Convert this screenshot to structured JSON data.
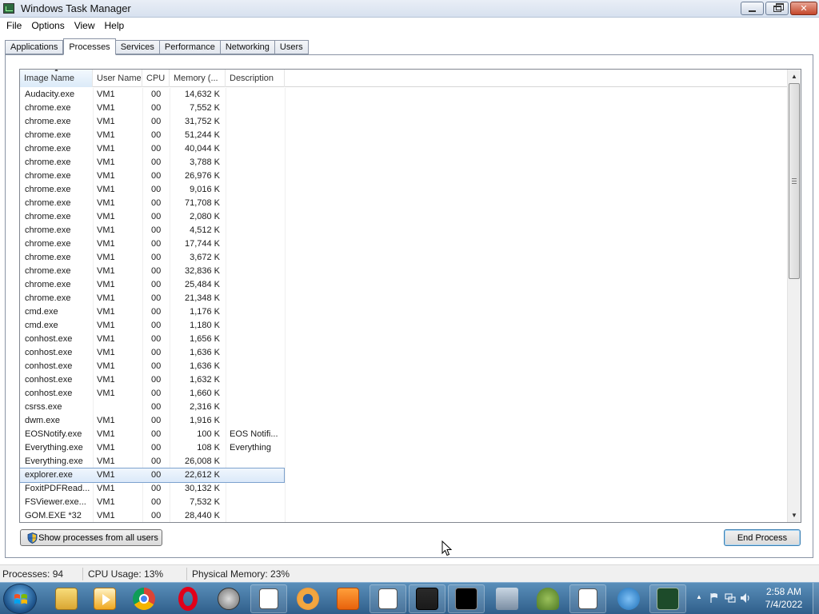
{
  "window": {
    "title": "Windows Task Manager"
  },
  "menu": [
    "File",
    "Options",
    "View",
    "Help"
  ],
  "tabs": [
    {
      "label": "Applications",
      "active": false
    },
    {
      "label": "Processes",
      "active": true
    },
    {
      "label": "Services",
      "active": false
    },
    {
      "label": "Performance",
      "active": false
    },
    {
      "label": "Networking",
      "active": false
    },
    {
      "label": "Users",
      "active": false
    }
  ],
  "columns": {
    "name": "Image Name",
    "user": "User Name",
    "cpu": "CPU",
    "memory": "Memory (...",
    "description": "Description"
  },
  "processes": [
    {
      "name": "Audacity.exe",
      "user": "VM1",
      "cpu": "00",
      "memory": "14,632 K",
      "description": ""
    },
    {
      "name": "chrome.exe",
      "user": "VM1",
      "cpu": "00",
      "memory": "7,552 K",
      "description": ""
    },
    {
      "name": "chrome.exe",
      "user": "VM1",
      "cpu": "00",
      "memory": "31,752 K",
      "description": ""
    },
    {
      "name": "chrome.exe",
      "user": "VM1",
      "cpu": "00",
      "memory": "51,244 K",
      "description": ""
    },
    {
      "name": "chrome.exe",
      "user": "VM1",
      "cpu": "00",
      "memory": "40,044 K",
      "description": ""
    },
    {
      "name": "chrome.exe",
      "user": "VM1",
      "cpu": "00",
      "memory": "3,788 K",
      "description": ""
    },
    {
      "name": "chrome.exe",
      "user": "VM1",
      "cpu": "00",
      "memory": "26,976 K",
      "description": ""
    },
    {
      "name": "chrome.exe",
      "user": "VM1",
      "cpu": "00",
      "memory": "9,016 K",
      "description": ""
    },
    {
      "name": "chrome.exe",
      "user": "VM1",
      "cpu": "00",
      "memory": "71,708 K",
      "description": ""
    },
    {
      "name": "chrome.exe",
      "user": "VM1",
      "cpu": "00",
      "memory": "2,080 K",
      "description": ""
    },
    {
      "name": "chrome.exe",
      "user": "VM1",
      "cpu": "00",
      "memory": "4,512 K",
      "description": ""
    },
    {
      "name": "chrome.exe",
      "user": "VM1",
      "cpu": "00",
      "memory": "17,744 K",
      "description": ""
    },
    {
      "name": "chrome.exe",
      "user": "VM1",
      "cpu": "00",
      "memory": "3,672 K",
      "description": ""
    },
    {
      "name": "chrome.exe",
      "user": "VM1",
      "cpu": "00",
      "memory": "32,836 K",
      "description": ""
    },
    {
      "name": "chrome.exe",
      "user": "VM1",
      "cpu": "00",
      "memory": "25,484 K",
      "description": ""
    },
    {
      "name": "chrome.exe",
      "user": "VM1",
      "cpu": "00",
      "memory": "21,348 K",
      "description": ""
    },
    {
      "name": "cmd.exe",
      "user": "VM1",
      "cpu": "00",
      "memory": "1,176 K",
      "description": ""
    },
    {
      "name": "cmd.exe",
      "user": "VM1",
      "cpu": "00",
      "memory": "1,180 K",
      "description": ""
    },
    {
      "name": "conhost.exe",
      "user": "VM1",
      "cpu": "00",
      "memory": "1,656 K",
      "description": ""
    },
    {
      "name": "conhost.exe",
      "user": "VM1",
      "cpu": "00",
      "memory": "1,636 K",
      "description": ""
    },
    {
      "name": "conhost.exe",
      "user": "VM1",
      "cpu": "00",
      "memory": "1,636 K",
      "description": ""
    },
    {
      "name": "conhost.exe",
      "user": "VM1",
      "cpu": "00",
      "memory": "1,632 K",
      "description": ""
    },
    {
      "name": "conhost.exe",
      "user": "VM1",
      "cpu": "00",
      "memory": "1,660 K",
      "description": ""
    },
    {
      "name": "csrss.exe",
      "user": "",
      "cpu": "00",
      "memory": "2,316 K",
      "description": ""
    },
    {
      "name": "dwm.exe",
      "user": "VM1",
      "cpu": "00",
      "memory": "1,916 K",
      "description": ""
    },
    {
      "name": "EOSNotify.exe",
      "user": "VM1",
      "cpu": "00",
      "memory": "100 K",
      "description": "EOS Notifi..."
    },
    {
      "name": "Everything.exe",
      "user": "VM1",
      "cpu": "00",
      "memory": "108 K",
      "description": "Everything"
    },
    {
      "name": "Everything.exe",
      "user": "VM1",
      "cpu": "00",
      "memory": "26,008 K",
      "description": ""
    },
    {
      "name": "explorer.exe",
      "user": "VM1",
      "cpu": "00",
      "memory": "22,612 K",
      "description": "",
      "selected": true
    },
    {
      "name": "FoxitPDFRead...",
      "user": "VM1",
      "cpu": "00",
      "memory": "30,132 K",
      "description": ""
    },
    {
      "name": "FSViewer.exe...",
      "user": "VM1",
      "cpu": "00",
      "memory": "7,532 K",
      "description": ""
    },
    {
      "name": "GOM.EXE *32",
      "user": "VM1",
      "cpu": "00",
      "memory": "28,440 K",
      "description": ""
    }
  ],
  "buttons": {
    "show_all": "Show processes from all users",
    "end_process": "End Process"
  },
  "status": {
    "processes": "Processes: 94",
    "cpu": "CPU Usage: 13%",
    "memory": "Physical Memory: 23%"
  },
  "taskbar": {
    "apps": [
      "explorer-icon",
      "media-player-icon",
      "chrome-icon",
      "opera-icon",
      "app-icon",
      "window-app-icon",
      "viewer-icon",
      "foxit-pdf-icon",
      "window-app-icon",
      "countdown-icon",
      "cmd-icon",
      "tools-icon",
      "tree-icon",
      "window-app-icon",
      "bird-icon",
      "task-manager-icon"
    ],
    "time": "2:58 AM",
    "date": "7/4/2022"
  }
}
